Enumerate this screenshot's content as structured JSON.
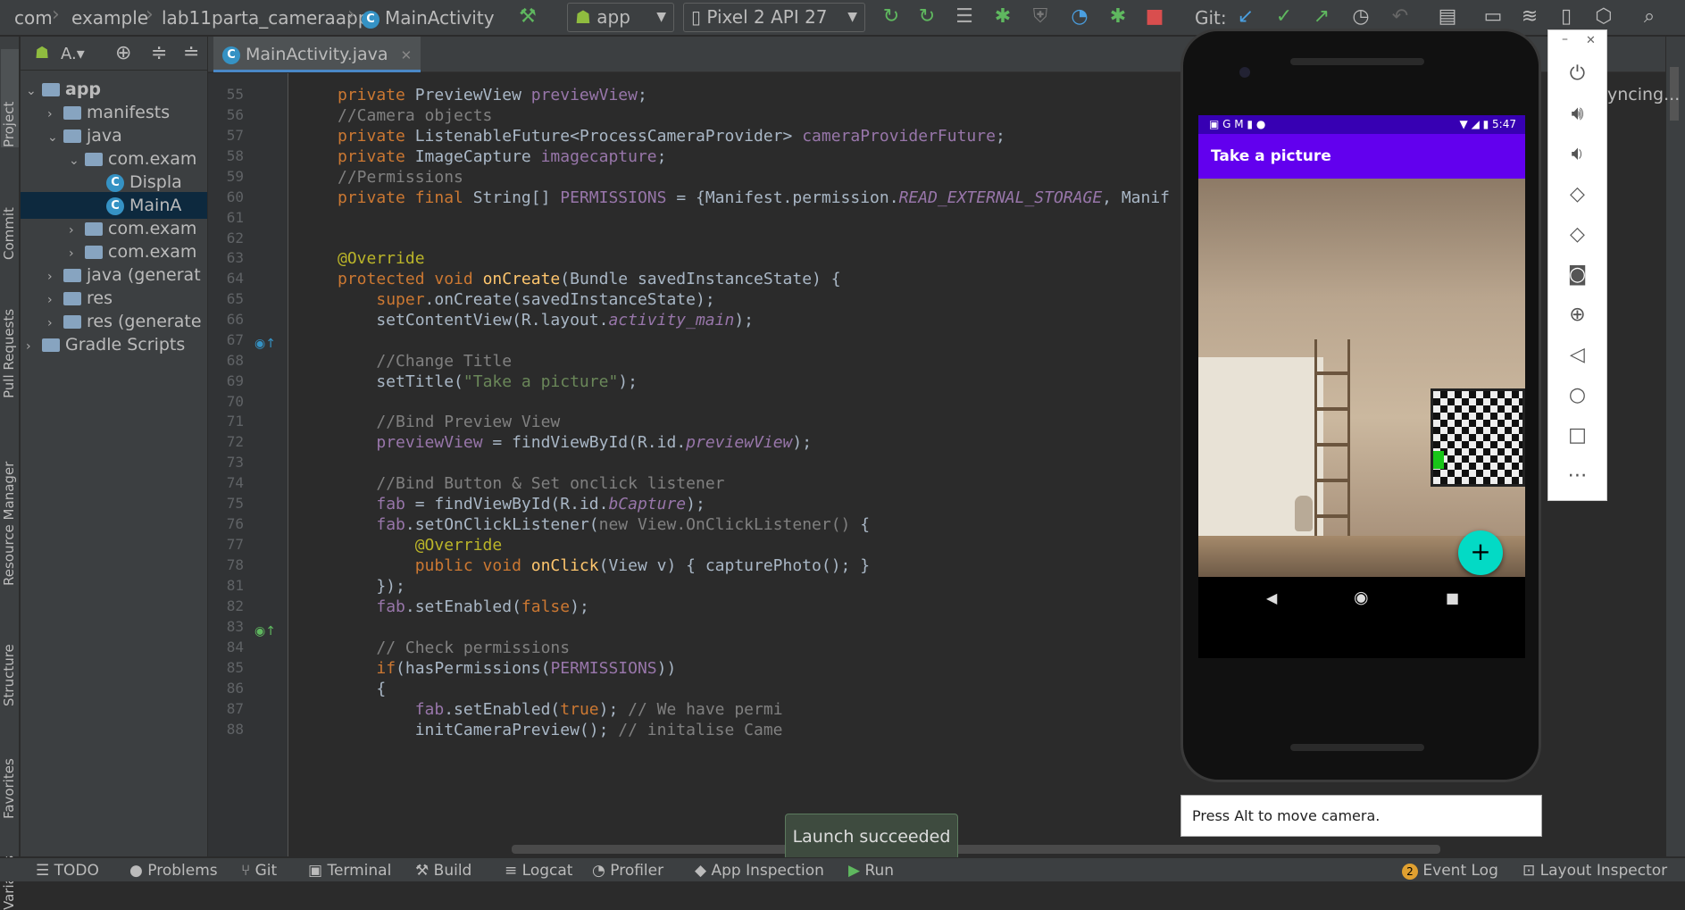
{
  "breadcrumb": [
    "com",
    "example",
    "lab11parta_cameraapp",
    "MainActivity"
  ],
  "toolbar": {
    "run_config": "app",
    "device": "Pixel 2 API 27",
    "git_label": "Git:"
  },
  "left_strip": [
    "Project",
    "Commit",
    "Pull Requests",
    "Resource Manager",
    "Structure",
    "Favorites",
    "Variants"
  ],
  "project": {
    "view_label": "A.",
    "tree": [
      {
        "label": "app",
        "indent": 0,
        "kind": "module"
      },
      {
        "label": "manifests",
        "indent": 1,
        "kind": "folder"
      },
      {
        "label": "java",
        "indent": 1,
        "kind": "folder"
      },
      {
        "label": "com.exam",
        "indent": 2,
        "kind": "folder"
      },
      {
        "label": "Displa",
        "indent": 3,
        "kind": "class"
      },
      {
        "label": "MainA",
        "indent": 3,
        "kind": "class"
      },
      {
        "label": "com.exam",
        "indent": 2,
        "kind": "folder"
      },
      {
        "label": "com.exam",
        "indent": 2,
        "kind": "folder"
      },
      {
        "label": "java (generat",
        "indent": 1,
        "kind": "folder"
      },
      {
        "label": "res",
        "indent": 1,
        "kind": "folder"
      },
      {
        "label": "res (generate",
        "indent": 1,
        "kind": "folder"
      },
      {
        "label": "Gradle Scripts",
        "indent": 0,
        "kind": "folder"
      }
    ]
  },
  "editor": {
    "tab": "MainActivity.java",
    "line_numbers": [
      "55",
      "56",
      "57",
      "58",
      "59",
      "60",
      "61",
      "62",
      "63",
      "64",
      "65",
      "66",
      "67",
      "68",
      "69",
      "70",
      "71",
      "72",
      "73",
      "74",
      "75",
      "76",
      "77",
      "78",
      "81",
      "82",
      "83",
      "84",
      "85",
      "86",
      "87",
      "88"
    ]
  },
  "emulator": {
    "time": "5:47",
    "app_title": "Take a picture",
    "fab_label": "+",
    "hint": "Press Alt to move camera.",
    "side_status": "yncing..."
  },
  "toast": "Launch succeeded",
  "bottom_tools": [
    "TODO",
    "Problems",
    "Git",
    "Terminal",
    "Build",
    "Logcat",
    "Profiler",
    "App Inspection",
    "Run"
  ],
  "bottom_right": {
    "event_log_count": "2",
    "event_log": "Event Log",
    "layout_inspector": "Layout Inspector"
  },
  "colors": {
    "accent": "#6200ee",
    "status": "#3700b3",
    "fab": "#03dac5"
  }
}
